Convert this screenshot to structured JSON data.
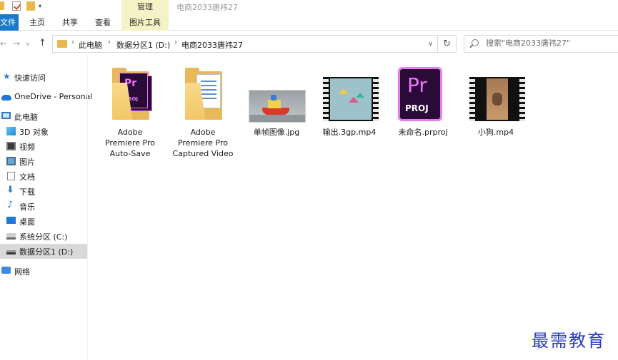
{
  "window": {
    "title": "电商2033唐祎27",
    "contextual_tab_header": "管理",
    "quick_access_dropdown": "▾"
  },
  "ribbon": {
    "tabs": [
      {
        "label": "文件"
      },
      {
        "label": "主页"
      },
      {
        "label": "共享"
      },
      {
        "label": "查看"
      },
      {
        "label": "图片工具"
      }
    ]
  },
  "navigation": {
    "back": "←",
    "forward": "→",
    "recent": "∨",
    "up": "↑"
  },
  "address": {
    "crumbs": [
      "此电脑",
      "数据分区1 (D:)",
      "电商2033唐祎27"
    ],
    "separator": "›",
    "dropdown": "∨",
    "refresh": "↻"
  },
  "search": {
    "placeholder": "搜索\"电商2033唐祎27\""
  },
  "sidebar": {
    "items": [
      {
        "label": "快速访问",
        "icon": "star-icon"
      },
      {
        "label": "OneDrive - Personal",
        "icon": "cloud-icon"
      },
      {
        "label": "此电脑",
        "icon": "computer-icon"
      },
      {
        "label": "3D 对象",
        "icon": "cube-icon"
      },
      {
        "label": "视频",
        "icon": "video-icon"
      },
      {
        "label": "图片",
        "icon": "picture-icon"
      },
      {
        "label": "文档",
        "icon": "document-icon"
      },
      {
        "label": "下载",
        "icon": "download-icon"
      },
      {
        "label": "音乐",
        "icon": "music-icon"
      },
      {
        "label": "桌面",
        "icon": "desktop-icon"
      },
      {
        "label": "系统分区 (C:)",
        "icon": "drive-icon"
      },
      {
        "label": "数据分区1 (D:)",
        "icon": "drive-icon",
        "selected": true
      },
      {
        "label": "网络",
        "icon": "network-icon"
      }
    ]
  },
  "files": [
    {
      "name": "Adobe Premiere Pro Auto-Save",
      "lines": [
        "Adobe",
        "Premiere Pro",
        "Auto-Save"
      ],
      "type": "folder",
      "badge_pr": "Pr",
      "badge_proj": "PROJ"
    },
    {
      "name": "Adobe Premiere Pro Captured Video",
      "lines": [
        "Adobe",
        "Premiere Pro",
        "Captured Video"
      ],
      "type": "folder"
    },
    {
      "name": "单帧图像.jpg",
      "lines": [
        "单帧图像.jpg"
      ],
      "type": "image"
    },
    {
      "name": "输出.3gp.mp4",
      "lines": [
        "输出.3gp.mp4"
      ],
      "type": "video"
    },
    {
      "name": "未命名.prproj",
      "lines": [
        "未命名.prproj"
      ],
      "type": "premiere-project",
      "badge_pr": "Pr",
      "badge_proj": "PROJ"
    },
    {
      "name": "小狗.mp4",
      "lines": [
        "小狗.mp4"
      ],
      "type": "video"
    }
  ],
  "watermark": "最需教育",
  "colors": {
    "file_tab": "#1979ca",
    "contextual_tab": "#f5f3c6",
    "selection": "#d9d9d9",
    "folder": "#e7b95a",
    "premiere": "#ea77ff"
  }
}
